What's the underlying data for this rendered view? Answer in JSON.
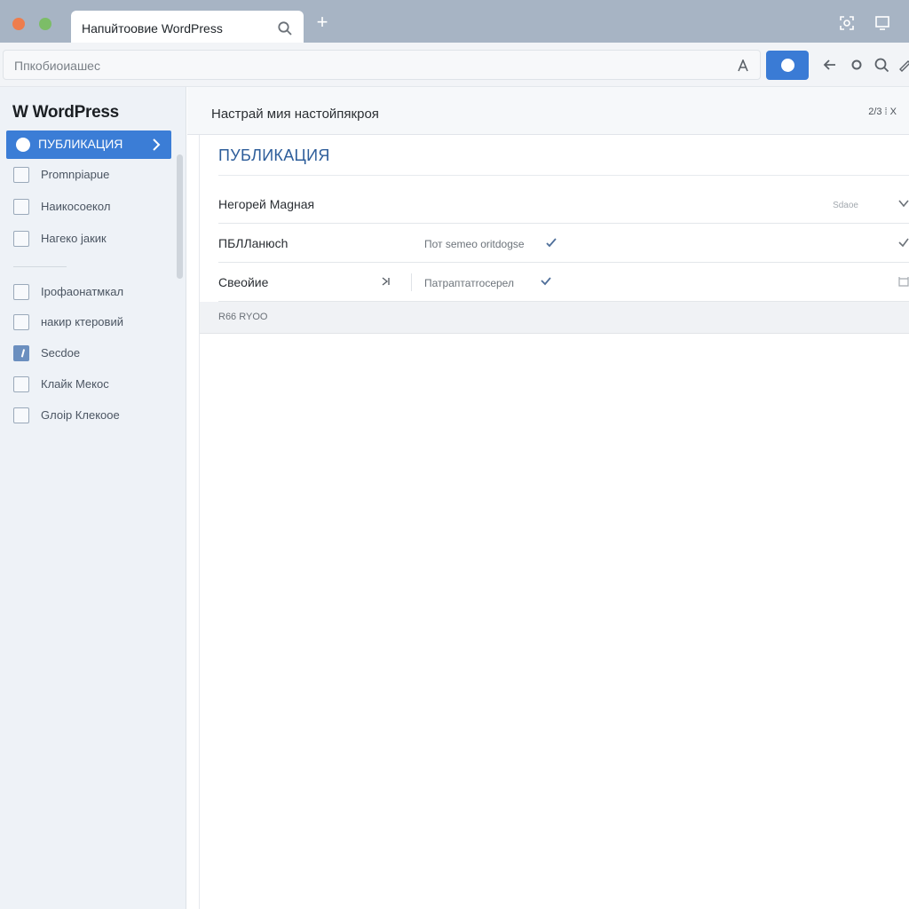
{
  "browser": {
    "tab_title": "Напuйтоовие WordPress",
    "new_tab_label": "+",
    "url_text": "Ппкобиоиашес"
  },
  "sidebar": {
    "brand": "W WordPress",
    "active_item": "ПУБЛИКАЦИЯ",
    "items": [
      {
        "label": "Promnpiapue",
        "checked": false
      },
      {
        "label": "Наикосоекол",
        "checked": false
      },
      {
        "label": "Нагеко jакик",
        "checked": false
      },
      {
        "label": "Ірофаонатмкал",
        "checked": false
      },
      {
        "label": "накир ктеровий",
        "checked": false
      },
      {
        "label": "Secdoe",
        "checked": true
      },
      {
        "label": "Клайк Мекос",
        "checked": false
      },
      {
        "label": "Gлоір Клeкоое",
        "checked": false
      }
    ]
  },
  "main": {
    "page_title": "Настрай мия настойпякроя",
    "header_meta": "2/3 ⁞ X",
    "section_title": "ПУБЛИКАЦИЯ",
    "rows": [
      {
        "label": "Негорей Мagнaя",
        "value": "",
        "right": "Sdaoe"
      },
      {
        "label": "ПБЛЛaнюch",
        "value": "Пот semeo oritdogse",
        "right": ""
      },
      {
        "label": "Свеойие",
        "value": "Патраптатrосерел",
        "right": ""
      }
    ],
    "footer": "R66 RYOO"
  },
  "colors": {
    "accent": "#3b7dd6",
    "section_title": "#2d5d9a",
    "sidebar_bg": "#eef2f7",
    "tabstrip_bg": "#a7b4c4"
  }
}
